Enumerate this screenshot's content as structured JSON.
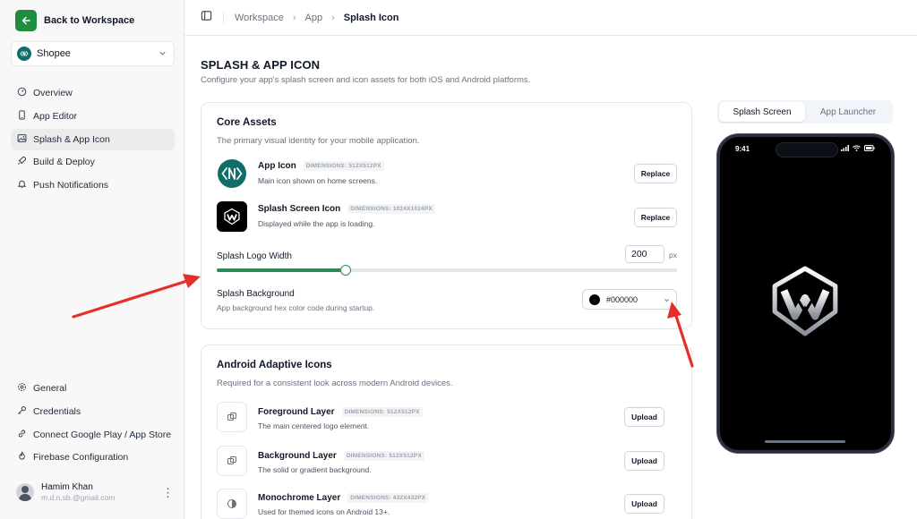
{
  "sidebar": {
    "back_label": "Back to Workspace",
    "app_name": "Shopee",
    "nav_top": [
      {
        "label": "Overview",
        "icon": "gauge-icon"
      },
      {
        "label": "App Editor",
        "icon": "phone-icon"
      },
      {
        "label": "Splash & App Icon",
        "icon": "image-icon",
        "active": true
      },
      {
        "label": "Build & Deploy",
        "icon": "rocket-icon"
      },
      {
        "label": "Push Notifications",
        "icon": "bell-icon"
      }
    ],
    "nav_bottom": [
      {
        "label": "General",
        "icon": "gear-icon"
      },
      {
        "label": "Credentials",
        "icon": "key-icon"
      },
      {
        "label": "Connect Google Play / App Store",
        "icon": "link-icon"
      },
      {
        "label": "Firebase Configuration",
        "icon": "flame-icon"
      }
    ],
    "user": {
      "name": "Hamim Khan",
      "email": "m.d.n.sb.@gmail.com"
    }
  },
  "breadcrumb": {
    "items": [
      "Workspace",
      "App"
    ],
    "current": "Splash Icon"
  },
  "page": {
    "title": "SPLASH & APP ICON",
    "subtitle": "Configure your app's splash screen and icon assets for both iOS and Android platforms."
  },
  "core": {
    "title": "Core Assets",
    "desc": "The primary visual identity for your mobile application.",
    "app_icon": {
      "name": "App Icon",
      "dim": "DIMENSIONS: 512X512PX",
      "desc": "Main icon shown on home screens.",
      "button": "Replace"
    },
    "splash_icon": {
      "name": "Splash Screen Icon",
      "dim": "DIMENSIONS: 1024X1024PX",
      "desc": "Displayed while the app is loading.",
      "button": "Replace"
    },
    "logo_width": {
      "label": "Splash Logo Width",
      "value": "200",
      "unit": "px",
      "fill_fraction": 0.28
    },
    "background": {
      "label": "Splash Background",
      "desc": "App background hex color code during startup.",
      "value": "#000000",
      "color": "#000000"
    }
  },
  "android": {
    "title": "Android Adaptive Icons",
    "desc": "Required for a consistent look across modern Android devices.",
    "layers": [
      {
        "name": "Foreground Layer",
        "dim": "DIMENSIONS: 512X512PX",
        "desc": "The main centered logo element.",
        "button": "Upload",
        "icon": "layers-icon"
      },
      {
        "name": "Background Layer",
        "dim": "DIMENSIONS: 512X512PX",
        "desc": "The solid or gradient background.",
        "button": "Upload",
        "icon": "layers-icon"
      },
      {
        "name": "Monochrome Layer",
        "dim": "DIMENSIONS: 432X432PX",
        "desc": "Used for themed icons on Android 13+.",
        "button": "Upload",
        "icon": "contrast-icon"
      }
    ]
  },
  "preview": {
    "tabs": [
      "Splash Screen",
      "App Launcher"
    ],
    "active_tab": 0,
    "time": "9:41",
    "background_color": "#000000"
  },
  "colors": {
    "accent": "#1e8e3e",
    "annotation": "#e5302a"
  }
}
